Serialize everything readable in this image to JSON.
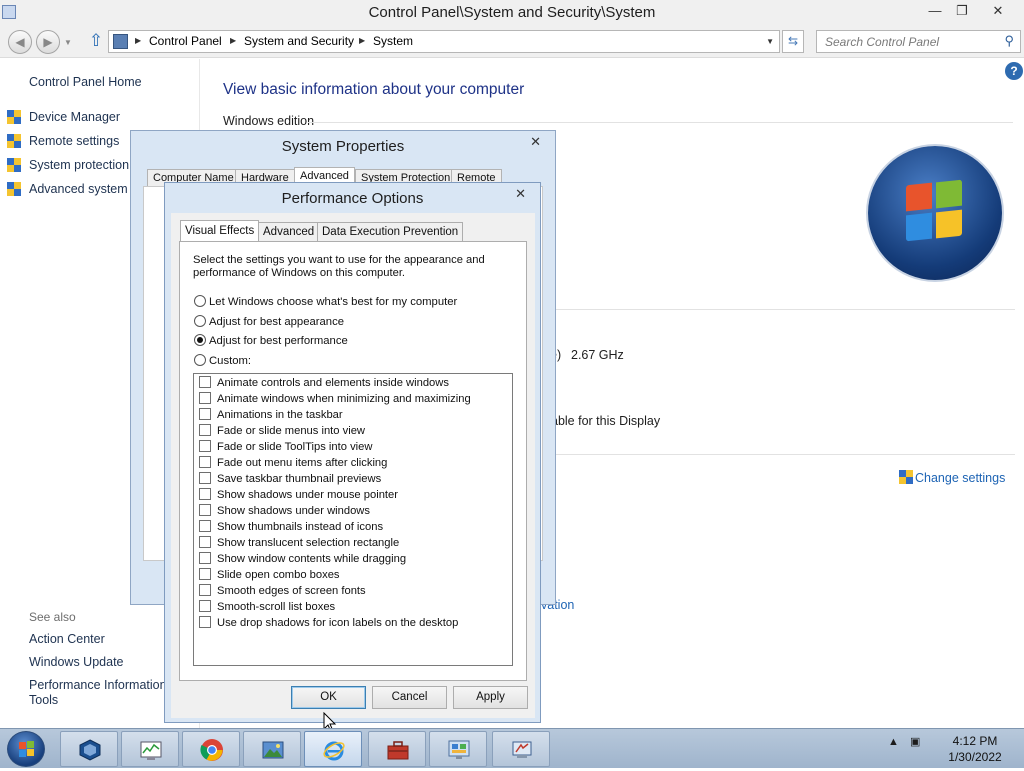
{
  "window": {
    "title": "Control Panel\\System and Security\\System",
    "buttons": {
      "minimize": "—",
      "restore": "❐",
      "close": "✕"
    }
  },
  "address_bar": {
    "segments": [
      "Control Panel",
      "System and Security",
      "System"
    ],
    "search_placeholder": "Search Control Panel"
  },
  "left_pane": {
    "home": "Control Panel Home",
    "tasks": [
      "Device Manager",
      "Remote settings",
      "System protection",
      "Advanced system s"
    ],
    "see_also_heading": "See also",
    "see_also": [
      "Action Center",
      "Windows Update",
      "Performance Information",
      "Tools"
    ]
  },
  "main": {
    "heading": "View basic information about your computer",
    "windows_edition": "Windows edition",
    "processor_fragment": "e)",
    "processor_speed": "2.67 GHz",
    "pen_touch_fragment": "able for this Display",
    "change_settings": "Change settings",
    "activation_fragment": "vation"
  },
  "system_properties": {
    "title": "System Properties",
    "tabs": [
      "Computer Name",
      "Hardware",
      "Advanced",
      "System Protection",
      "Remote"
    ],
    "active_tab": "Advanced"
  },
  "performance_options": {
    "title": "Performance Options",
    "tabs": [
      "Visual Effects",
      "Advanced",
      "Data Execution Prevention"
    ],
    "active_tab": "Visual Effects",
    "description": "Select the settings you want to use for the appearance and performance of Windows on this computer.",
    "radios": [
      {
        "label": "Let Windows choose what's best for my computer",
        "selected": false
      },
      {
        "label": "Adjust for best appearance",
        "selected": false
      },
      {
        "label": "Adjust for best performance",
        "selected": true
      },
      {
        "label": "Custom:",
        "selected": false
      }
    ],
    "effects": [
      {
        "label": "Animate controls and elements inside windows",
        "checked": false
      },
      {
        "label": "Animate windows when minimizing and maximizing",
        "checked": false
      },
      {
        "label": "Animations in the taskbar",
        "checked": false
      },
      {
        "label": "Fade or slide menus into view",
        "checked": false
      },
      {
        "label": "Fade or slide ToolTips into view",
        "checked": false
      },
      {
        "label": "Fade out menu items after clicking",
        "checked": false
      },
      {
        "label": "Save taskbar thumbnail previews",
        "checked": false
      },
      {
        "label": "Show shadows under mouse pointer",
        "checked": false
      },
      {
        "label": "Show shadows under windows",
        "checked": false
      },
      {
        "label": "Show thumbnails instead of icons",
        "checked": false
      },
      {
        "label": "Show translucent selection rectangle",
        "checked": false
      },
      {
        "label": "Show window contents while dragging",
        "checked": false
      },
      {
        "label": "Slide open combo boxes",
        "checked": false
      },
      {
        "label": "Smooth edges of screen fonts",
        "checked": false
      },
      {
        "label": "Smooth-scroll list boxes",
        "checked": false
      },
      {
        "label": "Use drop shadows for icon labels on the desktop",
        "checked": false
      }
    ],
    "buttons": {
      "ok": "OK",
      "cancel": "Cancel",
      "apply": "Apply"
    }
  },
  "taskbar": {
    "items": [
      "virtualbox-icon",
      "resource-monitor-icon",
      "chrome-icon",
      "photo-viewer-icon",
      "internet-explorer-icon",
      "toolbox-icon",
      "control-panel-icon",
      "system-properties-icon"
    ],
    "active_item": "internet-explorer-icon",
    "time": "4:12 PM",
    "date": "1/30/2022"
  },
  "colors": {
    "link": "#1e3250",
    "heading": "#1e3287",
    "accent_link": "#1e64b4",
    "dialog_frame": "#d9e6f4"
  }
}
